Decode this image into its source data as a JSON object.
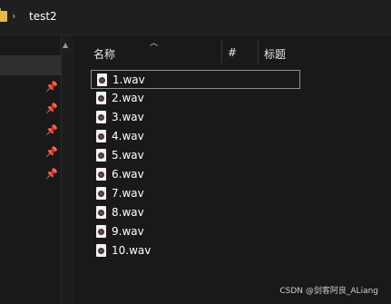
{
  "address_bar": {
    "path": "test2",
    "separator": "›"
  },
  "columns": {
    "name": "名称",
    "number": "#",
    "title": "标题"
  },
  "files": [
    {
      "name": "1.wav"
    },
    {
      "name": "2.wav"
    },
    {
      "name": "3.wav"
    },
    {
      "name": "4.wav"
    },
    {
      "name": "5.wav"
    },
    {
      "name": "6.wav"
    },
    {
      "name": "7.wav"
    },
    {
      "name": "8.wav"
    },
    {
      "name": "9.wav"
    },
    {
      "name": "10.wav"
    }
  ],
  "watermark": "CSDN @剑客阿良_ALiang",
  "colors": {
    "background": "#191919",
    "folder": "#e8b94a",
    "text": "#ffffff"
  }
}
